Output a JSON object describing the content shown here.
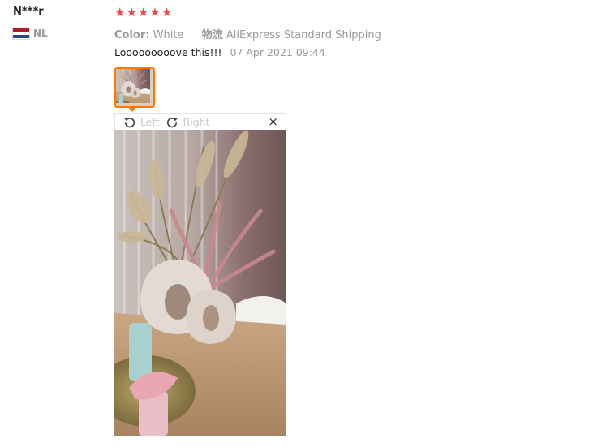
{
  "reviewer": {
    "name": "N***r",
    "country_code": "NL",
    "flag_colors": [
      "#ae1c28",
      "#ffffff",
      "#21468b"
    ]
  },
  "rating": {
    "stars": 5,
    "max": 5,
    "color": "#f5474f"
  },
  "sku": {
    "color_key": "Color:",
    "color_value": "White",
    "logistics_key": "物流",
    "logistics_value": "AliExpress Standard Shipping"
  },
  "review": {
    "text": "Looooooooove this!!!",
    "date": "07 Apr 2021 09:44"
  },
  "gallery": {
    "accent_color": "#ff7800",
    "rotate_left_label": "Left",
    "rotate_right_label": "Right",
    "close_label": "×",
    "icons": [
      "rotate-left-icon",
      "rotate-right-icon",
      "close-icon"
    ]
  }
}
